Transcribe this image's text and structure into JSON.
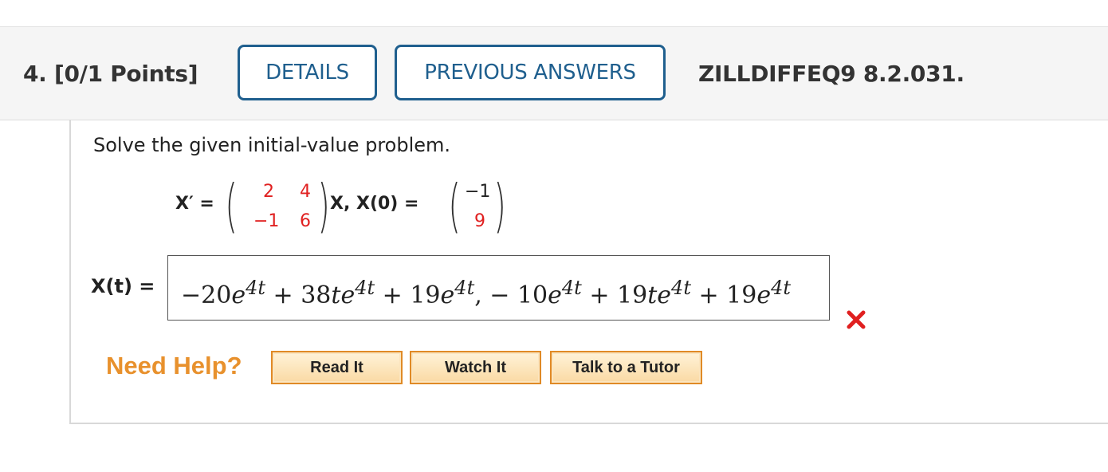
{
  "header": {
    "question_label": "4. [0/1 Points]",
    "details_label": "DETAILS",
    "previous_answers_label": "PREVIOUS ANSWERS",
    "problem_code": "ZILLDIFFEQ9 8.2.031."
  },
  "problem": {
    "instruction": "Solve the given initial-value problem.",
    "lhs": "X′ =",
    "matrix": [
      "2",
      "4",
      "−1",
      "6"
    ],
    "rhs_mid": "X, X(0) =",
    "initial_vector": [
      "−1",
      "9"
    ]
  },
  "answer": {
    "label": "X(t) =",
    "value": "−20e^{4t} + 38te^{4t} + 19e^{4t}, − 10e^{4t} + 19te^{4t} + 19e^{4t}",
    "status": "incorrect",
    "status_icon": "x-mark-icon",
    "status_color": "#e02020"
  },
  "help": {
    "label": "Need Help?",
    "buttons": [
      "Read It",
      "Watch It",
      "Talk to a Tutor"
    ]
  },
  "colors": {
    "accent_blue": "#1f5f8e",
    "help_orange": "#e8912d",
    "matrix_red": "#e02020"
  }
}
